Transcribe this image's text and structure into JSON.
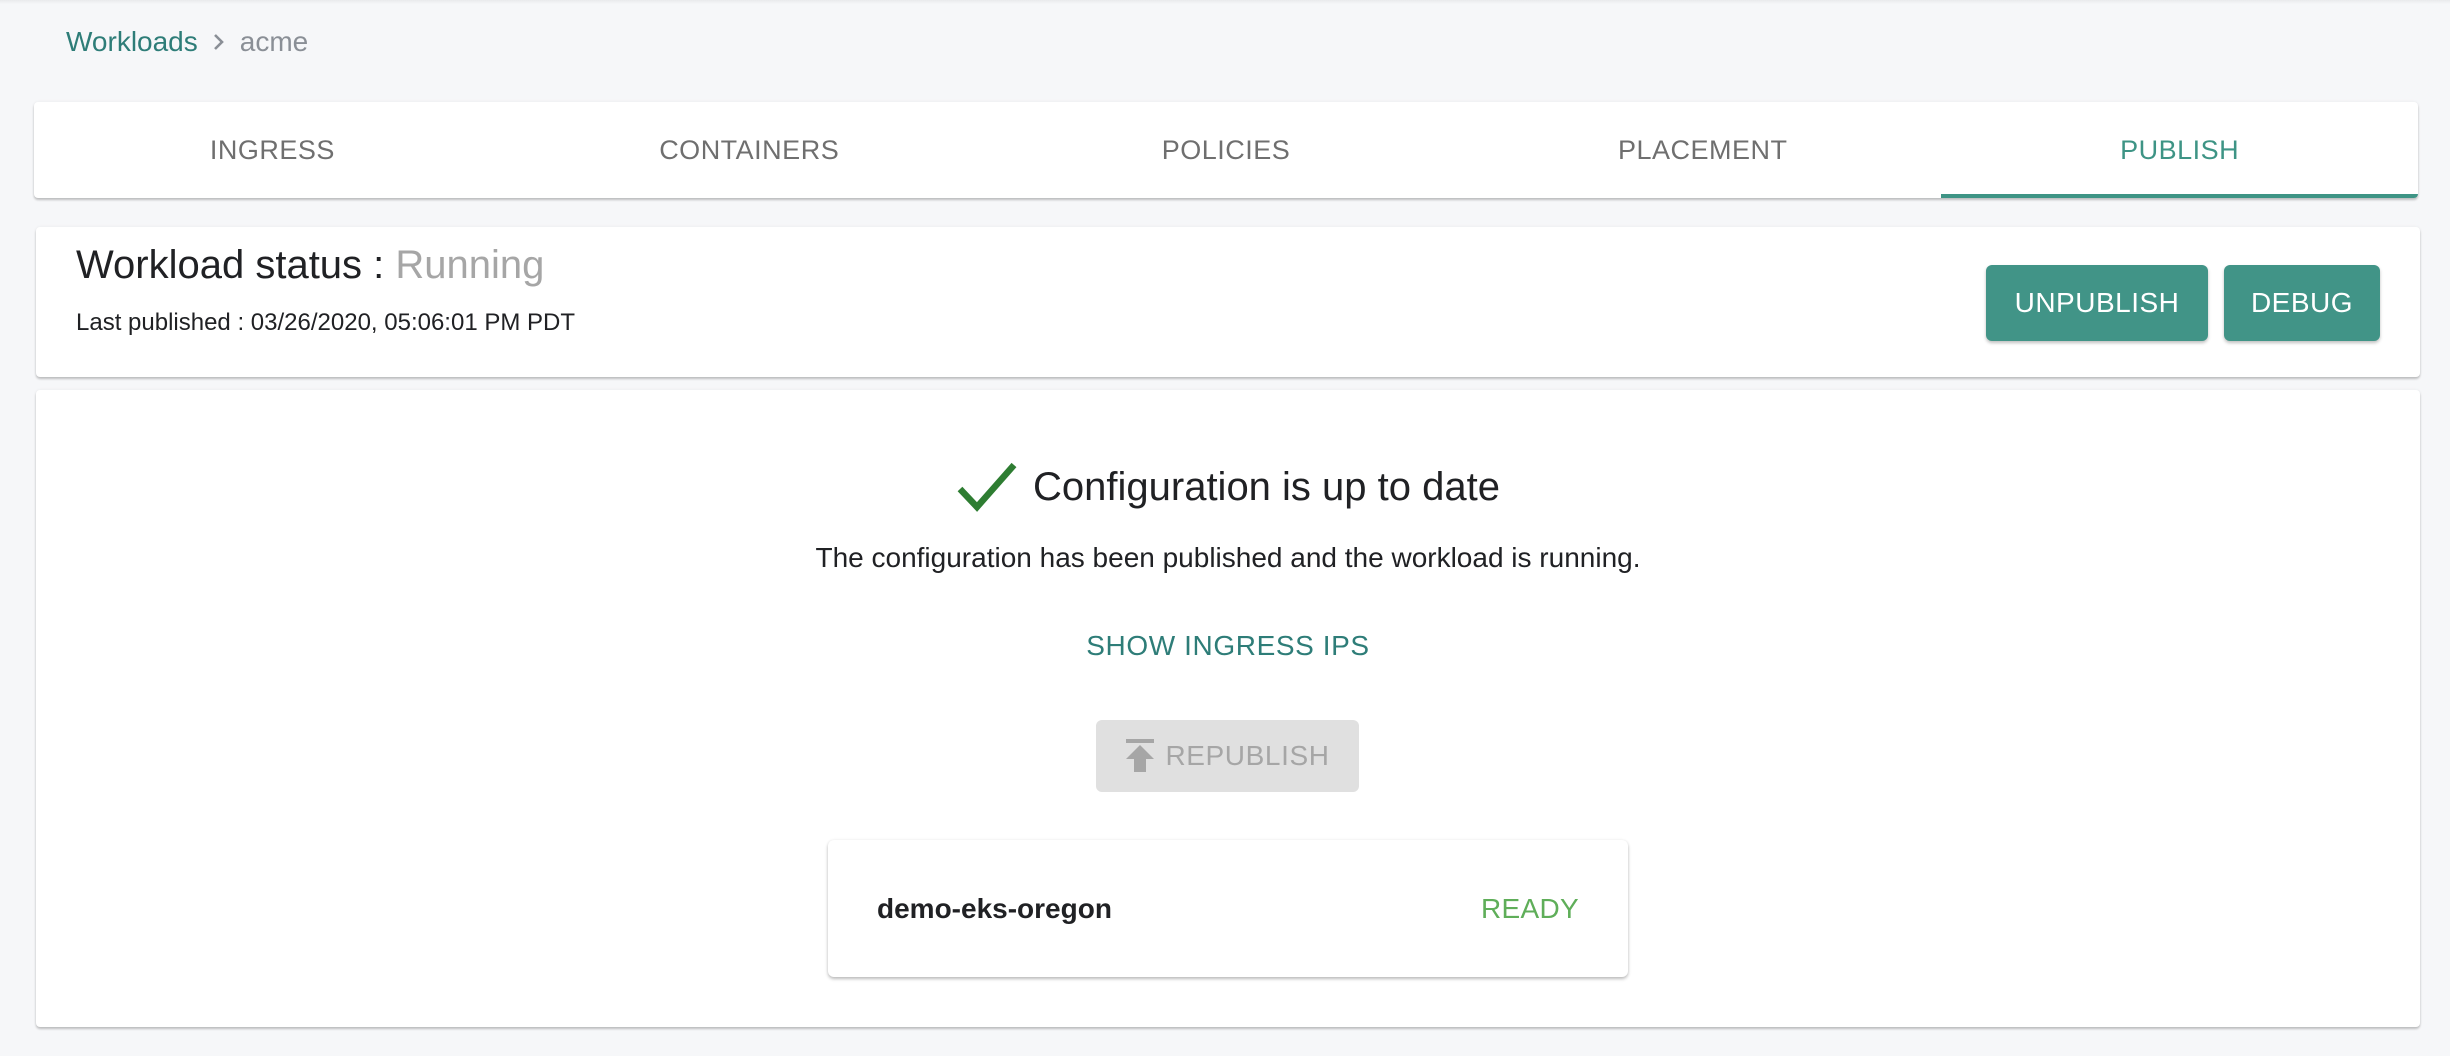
{
  "breadcrumb": {
    "parent": "Workloads",
    "separator_icon": "chevron-right-icon",
    "current": "acme"
  },
  "tabs": [
    {
      "label": "INGRESS",
      "active": false
    },
    {
      "label": "CONTAINERS",
      "active": false
    },
    {
      "label": "POLICIES",
      "active": false
    },
    {
      "label": "PLACEMENT",
      "active": false
    },
    {
      "label": "PUBLISH",
      "active": true
    }
  ],
  "status": {
    "label": "Workload status :",
    "value": "Running",
    "last_published_label": "Last published :",
    "last_published_value": "03/26/2020, 05:06:01 PM PDT",
    "unpublish_label": "UNPUBLISH",
    "debug_label": "DEBUG"
  },
  "publish": {
    "check_icon": "check-icon",
    "title": "Configuration is up to date",
    "description": "The configuration has been published and the workload is running.",
    "show_ingress_label": "SHOW INGRESS IPS",
    "republish_label": "REPUBLISH",
    "republish_icon": "publish-icon",
    "republish_disabled": true
  },
  "clusters": [
    {
      "name": "demo-eks-oregon",
      "status": "READY"
    }
  ],
  "colors": {
    "accent": "#419487",
    "link": "#2e7d78",
    "success": "#2e7d32",
    "ready": "#5fae59",
    "muted": "#a6a6a6",
    "background": "#f6f7f9"
  }
}
